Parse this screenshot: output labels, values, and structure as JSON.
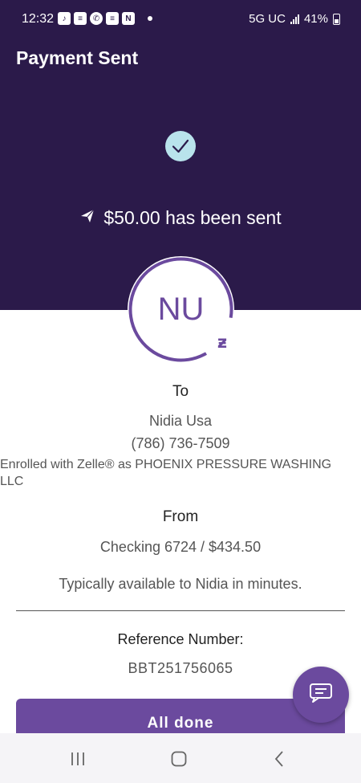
{
  "status_bar": {
    "time": "12:32",
    "network": "5G UC",
    "battery": "41%"
  },
  "header": {
    "title": "Payment Sent",
    "sent_message": "$50.00 has been sent"
  },
  "recipient": {
    "initials": "NU",
    "to_label": "To",
    "name": "Nidia Usa",
    "phone": "(786) 736-7509",
    "enrolled": "Enrolled with Zelle® as PHOENIX PRESSURE WASHING LLC"
  },
  "sender": {
    "from_label": "From",
    "account": "Checking 6724 / $434.50"
  },
  "availability": "Typically available to Nidia in minutes.",
  "reference": {
    "label": "Reference Number:",
    "value": "BBT251756065"
  },
  "actions": {
    "done_label": "All done"
  },
  "icons": {
    "check": "check-icon",
    "send": "paper-plane-icon",
    "zelle": "zelle-z-icon",
    "chat": "chat-icon"
  },
  "colors": {
    "header_bg": "#2b1a4a",
    "accent": "#6b4a9e",
    "check_bg": "#b9e3ec"
  }
}
